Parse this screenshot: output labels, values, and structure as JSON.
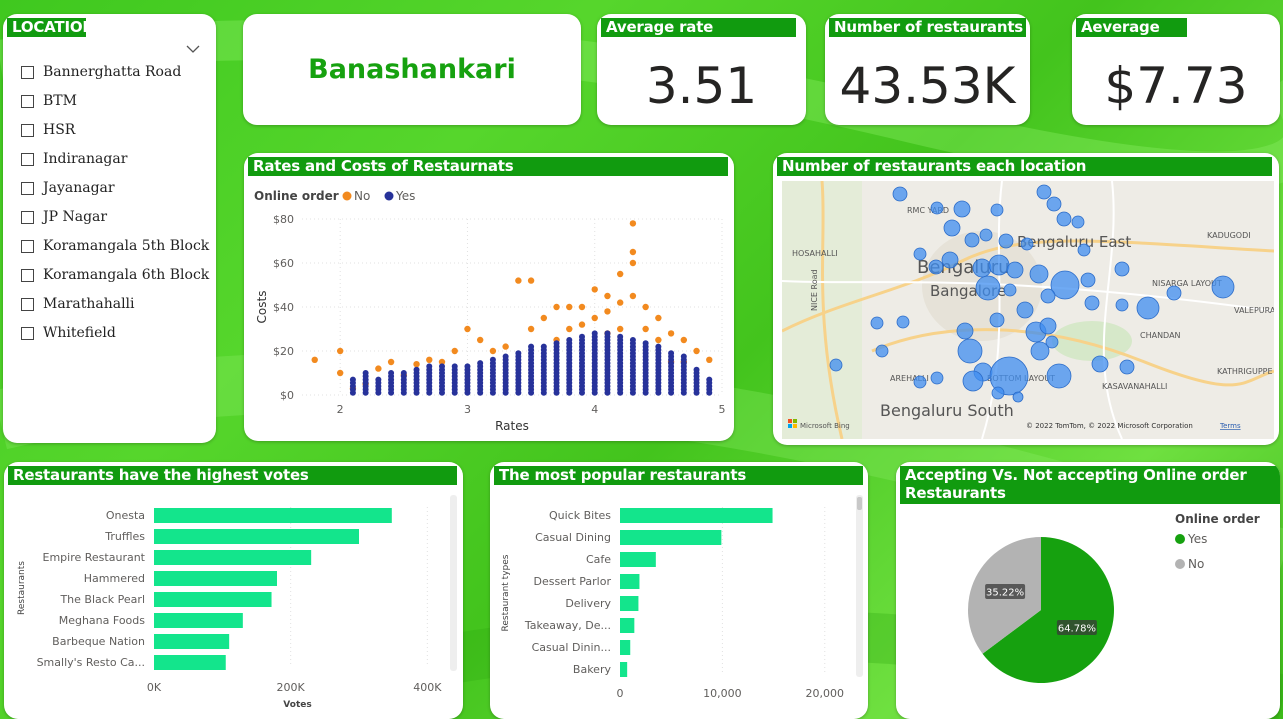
{
  "slicer": {
    "title": "LOCATION",
    "items": [
      "Bannerghatta Road",
      "BTM",
      "HSR",
      "Indiranagar",
      "Jayanagar",
      "JP Nagar",
      "Koramangala 5th Block",
      "Koramangala 6th Block",
      "Marathahalli",
      "Whitefield"
    ]
  },
  "selected_location": "Banashankari",
  "kpis": {
    "avg_rate": {
      "title": "Average rate",
      "value": "3.51"
    },
    "num_restaurants": {
      "title": "Number of restaurants",
      "value": "43.53K"
    },
    "avg_cost": {
      "title": "Aeverage cost",
      "value": "$7.73"
    }
  },
  "scatter_card": {
    "title": "Rates and Costs of Restaurnats"
  },
  "map_card": {
    "title": "Number of restaurants each location",
    "labels": [
      "RMC YARD",
      "HOSAHALLI",
      "Bengaluru East",
      "Bengaluru",
      "Bangalore",
      "KADUGODI",
      "NISARGA LAYOUT",
      "VALEPURA",
      "CHANDAN",
      "AREHALLI",
      "BOTTOM LAYOUT",
      "KASAVANAHALLI",
      "KATHRIGUPPE",
      "Bengaluru South",
      "NICE Road"
    ],
    "attribution": "© 2022 TomTom, © 2022 Microsoft Corporation",
    "terms": "Terms",
    "bing": "Microsoft Bing"
  },
  "votes_card": {
    "title": "Restaurants have the highest votes"
  },
  "popular_card": {
    "title": "The most popular restaurants"
  },
  "pie_card": {
    "title": "Accepting Vs. Not accepting Online order Restaurants"
  },
  "colors": {
    "green_header": "#119b0f",
    "bar_green": "#13e58c",
    "scatter_no": "#f28a1f",
    "scatter_yes": "#27329a",
    "pie_yes": "#16a10f",
    "pie_no": "#b3b3b3",
    "map_bubble": "#3f8df0"
  },
  "chart_data": [
    {
      "type": "scatter",
      "title": "Rates and Costs of Restaurnats",
      "xlabel": "Rates",
      "ylabel": "Costs",
      "legend_title": "Online order",
      "legend_placement": "top-left",
      "xlim": [
        1.8,
        4.9
      ],
      "ylim": [
        0,
        80
      ],
      "xticks": [
        "2",
        "3",
        "4",
        "5"
      ],
      "yticks": [
        "$0",
        "$20",
        "$40",
        "$60",
        "$80"
      ],
      "series": [
        {
          "name": "No",
          "color": "#f28a1f",
          "points": [
            [
              1.8,
              16
            ],
            [
              2.0,
              20
            ],
            [
              2.0,
              10
            ],
            [
              2.1,
              3
            ],
            [
              2.2,
              5
            ],
            [
              2.3,
              12
            ],
            [
              2.4,
              15
            ],
            [
              2.5,
              9
            ],
            [
              2.6,
              14
            ],
            [
              2.7,
              16
            ],
            [
              2.8,
              15
            ],
            [
              2.9,
              20
            ],
            [
              3.0,
              30
            ],
            [
              3.1,
              25
            ],
            [
              3.2,
              20
            ],
            [
              3.3,
              22
            ],
            [
              3.4,
              52
            ],
            [
              3.5,
              52
            ],
            [
              3.5,
              30
            ],
            [
              3.6,
              35
            ],
            [
              3.7,
              40
            ],
            [
              3.7,
              25
            ],
            [
              3.8,
              40
            ],
            [
              3.8,
              30
            ],
            [
              3.9,
              40
            ],
            [
              3.9,
              32
            ],
            [
              4.0,
              48
            ],
            [
              4.0,
              35
            ],
            [
              4.1,
              45
            ],
            [
              4.1,
              38
            ],
            [
              4.1,
              28
            ],
            [
              4.2,
              55
            ],
            [
              4.2,
              42
            ],
            [
              4.2,
              30
            ],
            [
              4.3,
              78
            ],
            [
              4.3,
              65
            ],
            [
              4.3,
              60
            ],
            [
              4.3,
              45
            ],
            [
              4.4,
              40
            ],
            [
              4.4,
              30
            ],
            [
              4.5,
              35
            ],
            [
              4.5,
              25
            ],
            [
              4.6,
              28
            ],
            [
              4.6,
              15
            ],
            [
              4.7,
              25
            ],
            [
              4.7,
              15
            ],
            [
              4.8,
              20
            ],
            [
              4.9,
              16
            ]
          ]
        },
        {
          "name": "Yes",
          "color": "#27329a",
          "points": [
            [
              2.1,
              8
            ],
            [
              2.2,
              10
            ],
            [
              2.3,
              8
            ],
            [
              2.4,
              10
            ],
            [
              2.5,
              11
            ],
            [
              2.6,
              12
            ],
            [
              2.7,
              13
            ],
            [
              2.8,
              13
            ],
            [
              2.9,
              13
            ],
            [
              3.0,
              14
            ],
            [
              3.1,
              15
            ],
            [
              3.2,
              16
            ],
            [
              3.3,
              18
            ],
            [
              3.4,
              20
            ],
            [
              3.5,
              22
            ],
            [
              3.6,
              23
            ],
            [
              3.7,
              24
            ],
            [
              3.8,
              26
            ],
            [
              3.9,
              27
            ],
            [
              4.0,
              28
            ],
            [
              4.1,
              28
            ],
            [
              4.2,
              27
            ],
            [
              4.3,
              26
            ],
            [
              4.4,
              24
            ],
            [
              4.5,
              22
            ],
            [
              4.6,
              20
            ],
            [
              4.7,
              18
            ],
            [
              4.8,
              12
            ],
            [
              4.9,
              8
            ]
          ]
        }
      ]
    },
    {
      "type": "bar",
      "title": "Restaurants have the highest votes",
      "orientation": "horizontal",
      "xlabel": "Votes",
      "ylabel": "Restaurants",
      "categories": [
        "Onesta",
        "Truffles",
        "Empire Restaurant",
        "Hammered",
        "The Black Pearl",
        "Meghana Foods",
        "Barbeque Nation",
        "Smally's Resto Ca..."
      ],
      "values": [
        348000,
        300000,
        230000,
        180000,
        172000,
        130000,
        110000,
        105000
      ],
      "xlim": [
        0,
        420000
      ],
      "xticks": [
        "0K",
        "200K",
        "400K"
      ]
    },
    {
      "type": "bar",
      "title": "The most popular restaurants",
      "orientation": "horizontal",
      "xlabel": "",
      "ylabel": "Restaurant types",
      "categories": [
        "Quick Bites",
        "Casual Dining",
        "Cafe",
        "Dessert Parlor",
        "Delivery",
        "Takeaway, De...",
        "Casual Dinin...",
        "Bakery"
      ],
      "values": [
        14900,
        9900,
        3500,
        1900,
        1800,
        1400,
        1000,
        700
      ],
      "xlim": [
        0,
        21000
      ],
      "xticks": [
        "0",
        "10,000",
        "20,000"
      ]
    },
    {
      "type": "pie",
      "title": "Accepting Vs. Not accepting Online order Restaurants",
      "legend_title": "Online order",
      "legend_placement": "right",
      "categories": [
        "Yes",
        "No"
      ],
      "values": [
        64.78,
        35.22
      ],
      "labels": [
        "64.78%",
        "35.22%"
      ]
    }
  ]
}
